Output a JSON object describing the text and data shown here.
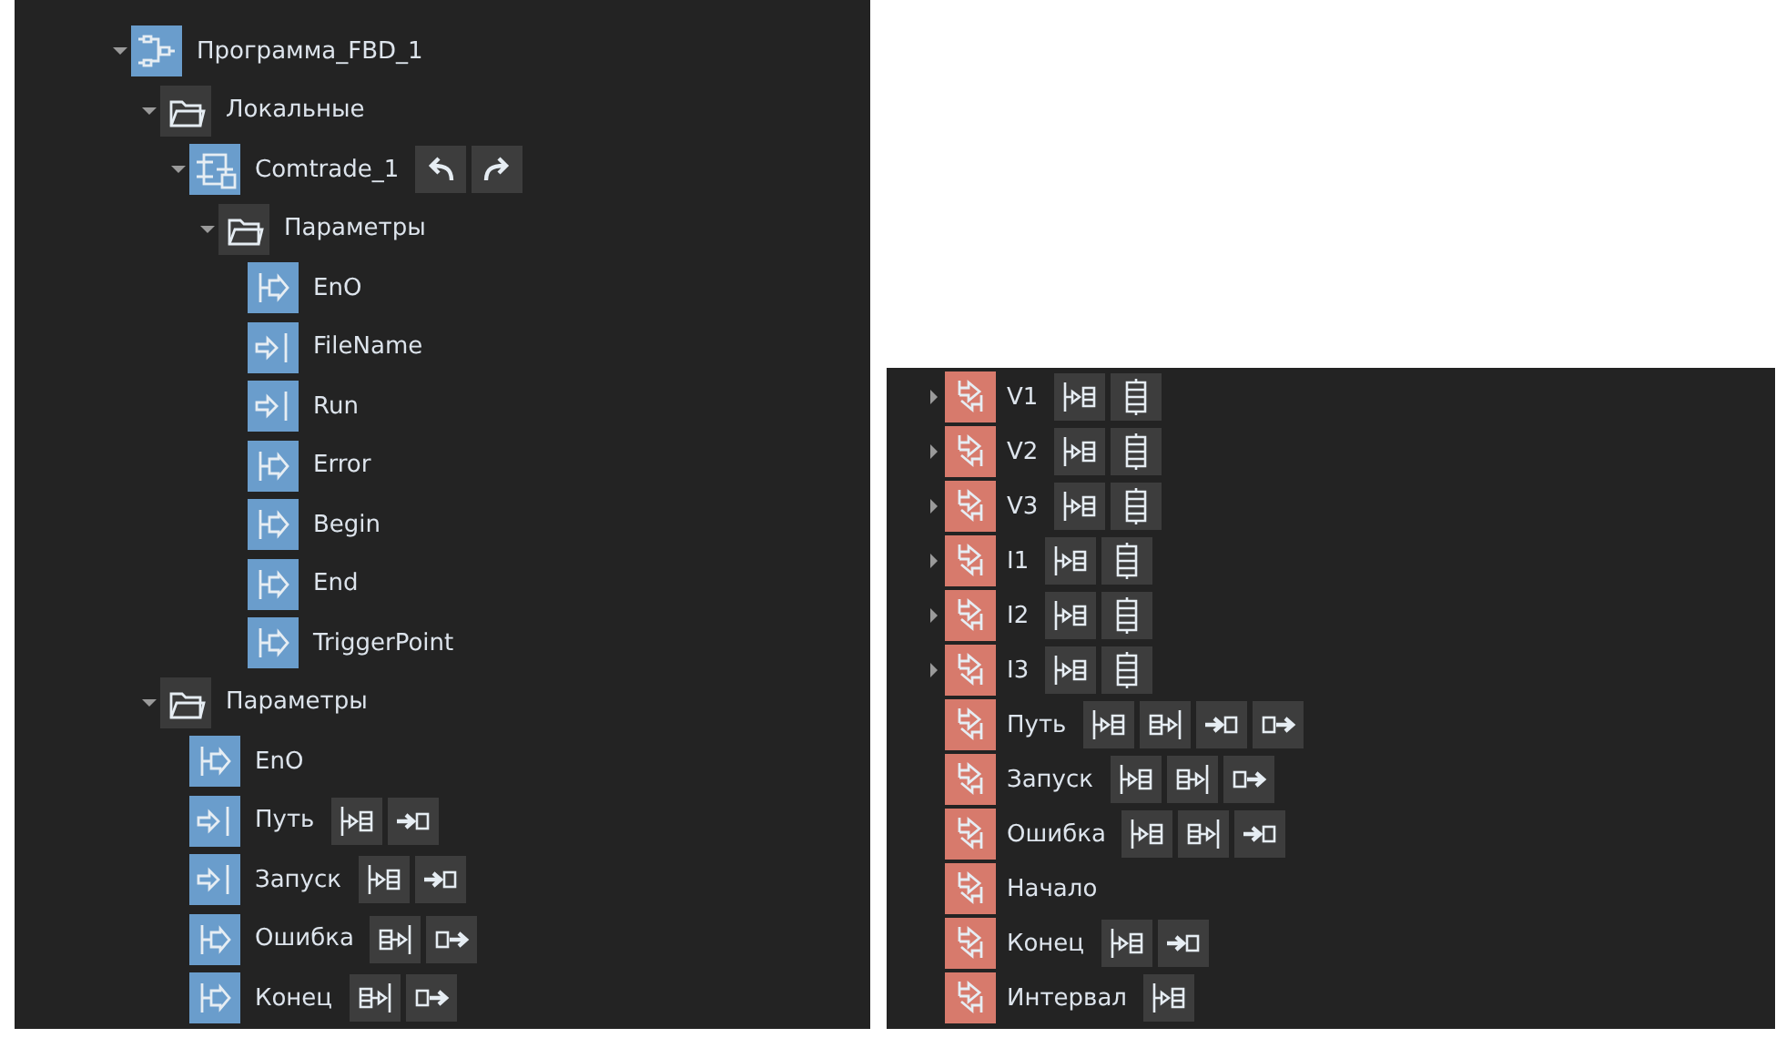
{
  "tree": [
    {
      "label": "Программа_FBD_1",
      "kind": "program",
      "expanded": true,
      "children": [
        {
          "label": "Локальные",
          "kind": "folder",
          "expanded": true,
          "children": [
            {
              "label": "Comtrade_1",
              "kind": "block",
              "expanded": true,
              "actions": [
                {
                  "kind": "undo"
                },
                {
                  "kind": "redo"
                }
              ],
              "children": [
                {
                  "label": "Параметры",
                  "kind": "folder",
                  "expanded": true,
                  "children": [
                    {
                      "label": "EnO",
                      "kind": "output"
                    },
                    {
                      "label": "FileName",
                      "kind": "input"
                    },
                    {
                      "label": "Run",
                      "kind": "input"
                    },
                    {
                      "label": "Error",
                      "kind": "output"
                    },
                    {
                      "label": "Begin",
                      "kind": "output"
                    },
                    {
                      "label": "End",
                      "kind": "output"
                    },
                    {
                      "label": "TriggerPoint",
                      "kind": "output"
                    }
                  ]
                }
              ]
            }
          ]
        },
        {
          "label": "Параметры",
          "kind": "folder",
          "expanded": true,
          "children": [
            {
              "label": "EnO",
              "kind": "output"
            },
            {
              "label": "Путь",
              "kind": "input",
              "actions": [
                {
                  "kind": "bind-in"
                },
                {
                  "kind": "arrow-in"
                }
              ]
            },
            {
              "label": "Запуск",
              "kind": "input",
              "actions": [
                {
                  "kind": "bind-in"
                },
                {
                  "kind": "arrow-in"
                }
              ]
            },
            {
              "label": "Ошибка",
              "kind": "output",
              "actions": [
                {
                  "kind": "bind-out"
                },
                {
                  "kind": "arrow-out"
                }
              ]
            },
            {
              "label": "Конец",
              "kind": "output",
              "actions": [
                {
                  "kind": "bind-out"
                },
                {
                  "kind": "arrow-out"
                }
              ]
            }
          ]
        }
      ]
    }
  ],
  "variables": [
    {
      "label": "V1",
      "kind": "variable",
      "expanded": false,
      "actions": [
        {
          "kind": "bind-in"
        },
        {
          "kind": "array"
        }
      ]
    },
    {
      "label": "V2",
      "kind": "variable",
      "expanded": false,
      "actions": [
        {
          "kind": "bind-in"
        },
        {
          "kind": "array"
        }
      ]
    },
    {
      "label": "V3",
      "kind": "variable",
      "expanded": false,
      "actions": [
        {
          "kind": "bind-in"
        },
        {
          "kind": "array"
        }
      ]
    },
    {
      "label": "I1",
      "kind": "variable",
      "expanded": false,
      "actions": [
        {
          "kind": "bind-in"
        },
        {
          "kind": "array"
        }
      ]
    },
    {
      "label": "I2",
      "kind": "variable",
      "expanded": false,
      "actions": [
        {
          "kind": "bind-in"
        },
        {
          "kind": "array"
        }
      ]
    },
    {
      "label": "I3",
      "kind": "variable",
      "expanded": false,
      "actions": [
        {
          "kind": "bind-in"
        },
        {
          "kind": "array"
        }
      ]
    },
    {
      "label": "Путь",
      "kind": "variable",
      "actions": [
        {
          "kind": "bind-in"
        },
        {
          "kind": "bind-out"
        },
        {
          "kind": "arrow-in"
        },
        {
          "kind": "arrow-out"
        }
      ]
    },
    {
      "label": "Запуск",
      "kind": "variable",
      "actions": [
        {
          "kind": "bind-in"
        },
        {
          "kind": "bind-out"
        },
        {
          "kind": "arrow-out"
        }
      ]
    },
    {
      "label": "Ошибка",
      "kind": "variable",
      "actions": [
        {
          "kind": "bind-in"
        },
        {
          "kind": "bind-out"
        },
        {
          "kind": "arrow-in"
        }
      ]
    },
    {
      "label": "Начало",
      "kind": "variable"
    },
    {
      "label": "Конец",
      "kind": "variable",
      "actions": [
        {
          "kind": "bind-in"
        },
        {
          "kind": "arrow-in"
        }
      ]
    },
    {
      "label": "Интервал",
      "kind": "variable",
      "actions": [
        {
          "kind": "bind-in"
        }
      ]
    }
  ]
}
